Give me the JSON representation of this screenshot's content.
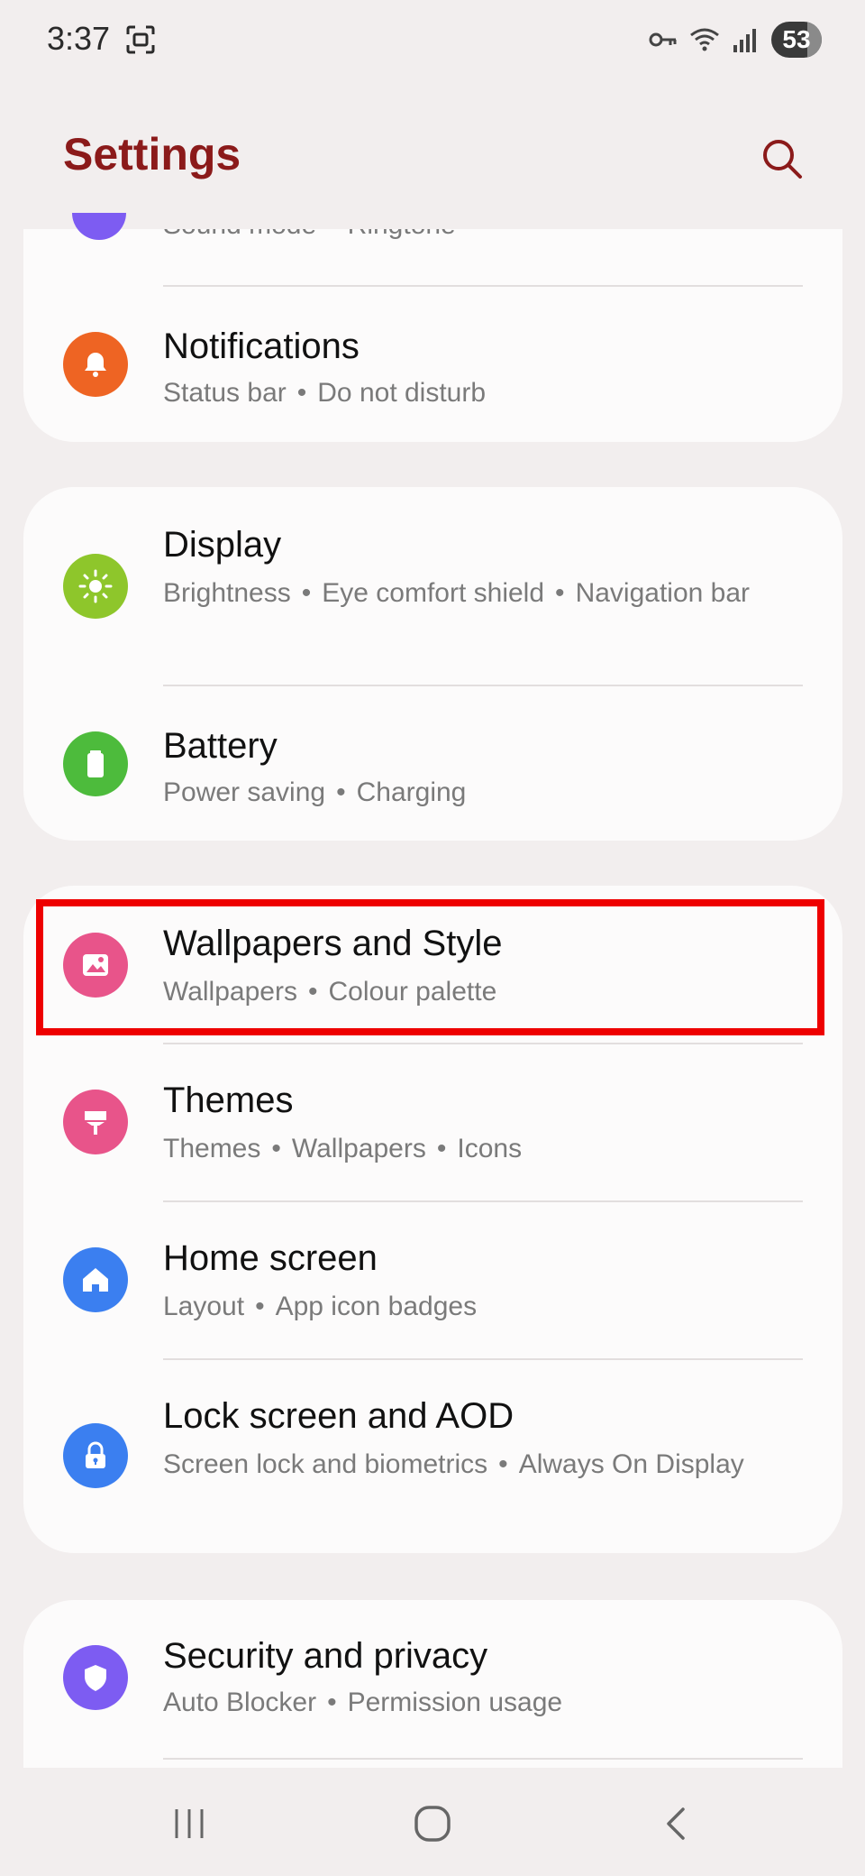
{
  "status_bar": {
    "time": "3:37",
    "battery": "53"
  },
  "header": {
    "title": "Settings"
  },
  "partial_item": {
    "subtitle": [
      "Sound mode",
      "Ringtone"
    ]
  },
  "items": [
    {
      "id": "notifications",
      "title": "Notifications",
      "subtitle": [
        "Status bar",
        "Do not disturb"
      ],
      "icon": "bell-icon",
      "color": "#ee6423"
    },
    {
      "id": "display",
      "title": "Display",
      "subtitle": [
        "Brightness",
        "Eye comfort shield",
        "Navigation bar"
      ],
      "icon": "sun-icon",
      "color": "#8ec62b"
    },
    {
      "id": "battery",
      "title": "Battery",
      "subtitle": [
        "Power saving",
        "Charging"
      ],
      "icon": "battery-icon",
      "color": "#4dbb3c"
    },
    {
      "id": "wallpapers",
      "title": "Wallpapers and Style",
      "subtitle": [
        "Wallpapers",
        "Colour palette"
      ],
      "icon": "image-icon",
      "color": "#e8548a"
    },
    {
      "id": "themes",
      "title": "Themes",
      "subtitle": [
        "Themes",
        "Wallpapers",
        "Icons"
      ],
      "icon": "paintbrush-icon",
      "color": "#e8548a"
    },
    {
      "id": "home",
      "title": "Home screen",
      "subtitle": [
        "Layout",
        "App icon badges"
      ],
      "icon": "home-icon",
      "color": "#3b7ff0"
    },
    {
      "id": "lock",
      "title": "Lock screen and AOD",
      "subtitle": [
        "Screen lock and biometrics",
        "Always On Display"
      ],
      "icon": "lock-icon",
      "color": "#3b7ff0"
    },
    {
      "id": "security",
      "title": "Security and privacy",
      "subtitle": [
        "Auto Blocker",
        "Permission usage"
      ],
      "icon": "shield-icon",
      "color": "#7d5cf2"
    }
  ],
  "colors": {
    "accent": "#8b1a1a",
    "highlight": "#ee0000"
  }
}
